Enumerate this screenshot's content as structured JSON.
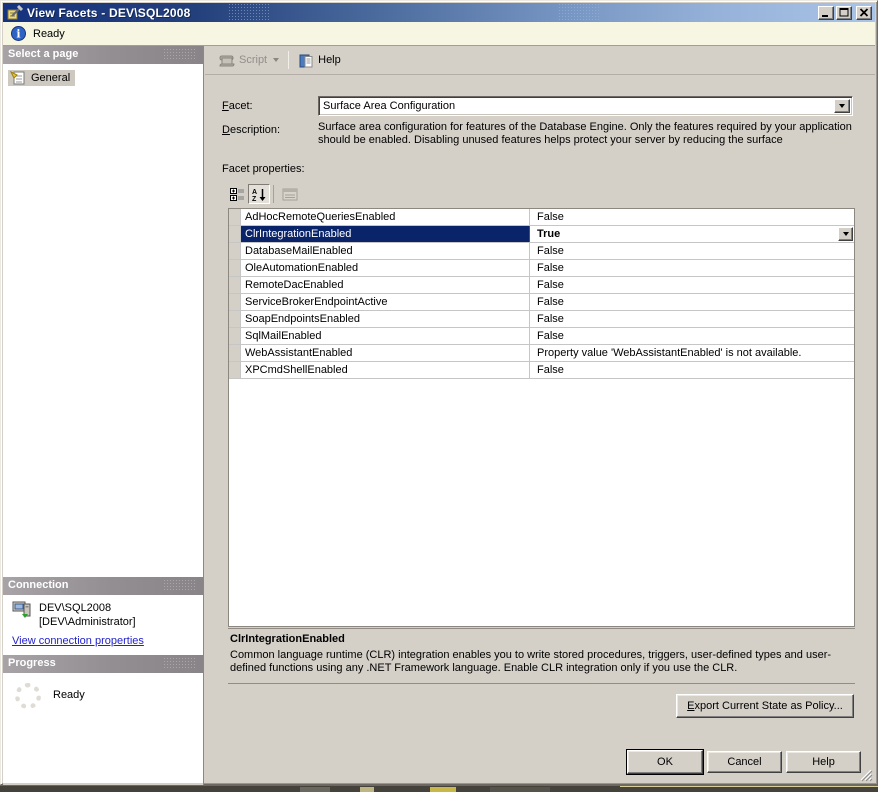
{
  "window": {
    "title": "View Facets - DEV\\SQL2008"
  },
  "status_bar": {
    "text": "Ready"
  },
  "sidebar": {
    "select_page": {
      "header": "Select a page",
      "items": [
        {
          "label": "General",
          "selected": true
        }
      ]
    },
    "connection": {
      "header": "Connection",
      "server": "DEV\\SQL2008",
      "account": "[DEV\\Administrator]",
      "link": "View connection properties"
    },
    "progress": {
      "header": "Progress",
      "status": "Ready"
    }
  },
  "toolbar": {
    "script_label": "Script",
    "help_label": "Help"
  },
  "main": {
    "facet_label": "Facet:",
    "facet_value": "Surface Area Configuration",
    "description_label": "Description:",
    "description_text": "Surface area configuration for features of the Database Engine. Only the features required by your application should be enabled. Disabling unused features helps protect your server by reducing the surface",
    "facet_properties_label": "Facet properties:",
    "grid": {
      "rows": [
        {
          "name": "AdHocRemoteQueriesEnabled",
          "value": "False",
          "selected": false
        },
        {
          "name": "ClrIntegrationEnabled",
          "value": "True",
          "selected": true
        },
        {
          "name": "DatabaseMailEnabled",
          "value": "False",
          "selected": false
        },
        {
          "name": "OleAutomationEnabled",
          "value": "False",
          "selected": false
        },
        {
          "name": "RemoteDacEnabled",
          "value": "False",
          "selected": false
        },
        {
          "name": "ServiceBrokerEndpointActive",
          "value": "False",
          "selected": false
        },
        {
          "name": "SoapEndpointsEnabled",
          "value": "False",
          "selected": false
        },
        {
          "name": "SqlMailEnabled",
          "value": "False",
          "selected": false
        },
        {
          "name": "WebAssistantEnabled",
          "value": "Property value 'WebAssistantEnabled' is not available.",
          "selected": false
        },
        {
          "name": "XPCmdShellEnabled",
          "value": "False",
          "selected": false
        }
      ]
    },
    "detail": {
      "title": "ClrIntegrationEnabled",
      "text": "Common language runtime (CLR) integration enables you to write stored procedures, triggers, user-defined types and user-defined functions using any .NET Framework language. Enable CLR integration only if you use the CLR."
    },
    "export_button": "Export Current State as Policy..."
  },
  "footer": {
    "ok": "OK",
    "cancel": "Cancel",
    "help": "Help"
  },
  "colors": {
    "titlebar_left": "#16337e",
    "titlebar_right": "#a9c4e6",
    "selection": "#0a246a",
    "dialog_bg": "#d4d0c8",
    "status_bg": "#f6f6e3",
    "link": "#2222cc"
  }
}
